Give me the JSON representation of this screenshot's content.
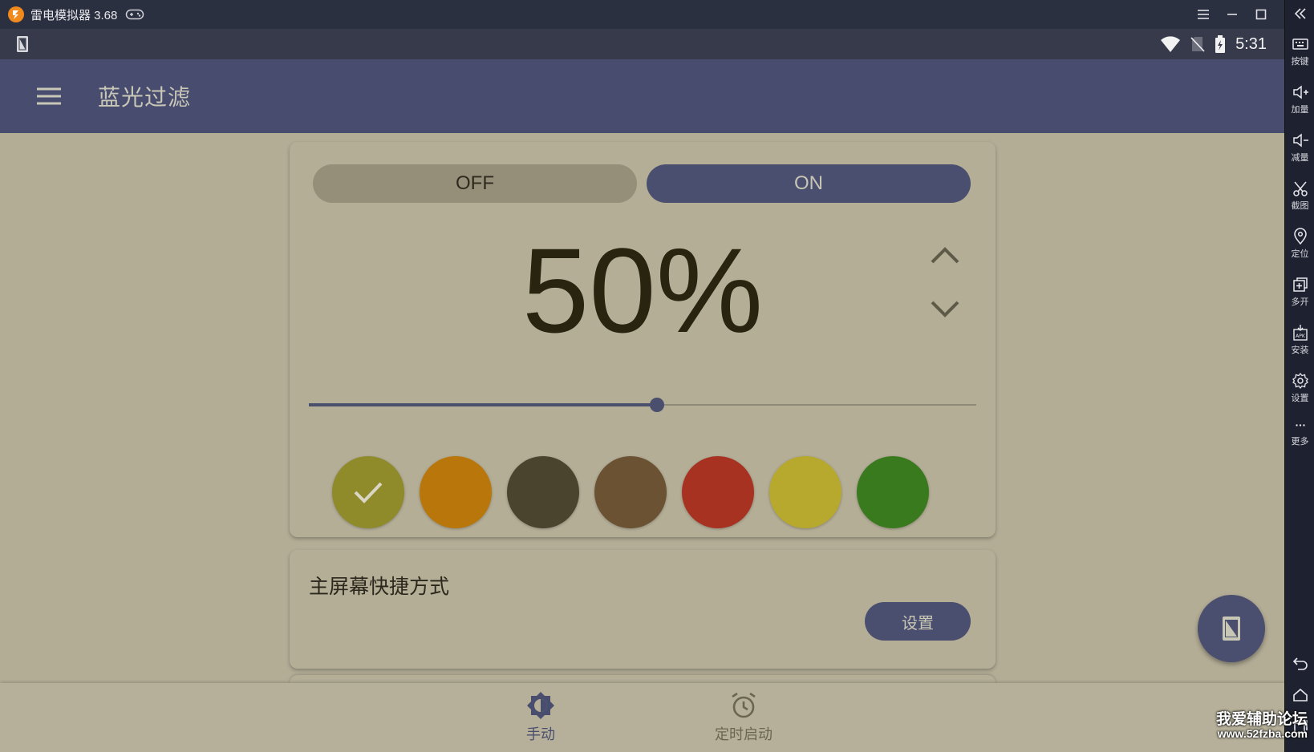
{
  "emulator": {
    "title": "雷电模拟器 3.68",
    "accent_color": "#f08a1c",
    "toolbar": [
      {
        "icon": "keyboard-icon",
        "label": "按键"
      },
      {
        "icon": "volume-up-icon",
        "label": "加量"
      },
      {
        "icon": "volume-down-icon",
        "label": "减量"
      },
      {
        "icon": "scissors-icon",
        "label": "截图"
      },
      {
        "icon": "location-pin-icon",
        "label": "定位"
      },
      {
        "icon": "multi-instance-icon",
        "label": "多开"
      },
      {
        "icon": "apk-install-icon",
        "label": "安装"
      },
      {
        "icon": "gear-icon",
        "label": "设置"
      },
      {
        "icon": "more-dots-icon",
        "label": "更多"
      }
    ]
  },
  "status_bar": {
    "time": "5:31"
  },
  "app_bar": {
    "title": "蓝光过滤"
  },
  "filter_card": {
    "toggle": {
      "off_label": "OFF",
      "on_label": "ON",
      "selected": "ON"
    },
    "intensity_label": "50%",
    "intensity_value": 50,
    "colors": [
      "#8f8a2a",
      "#b9760a",
      "#4a432e",
      "#6b5233",
      "#a83222",
      "#b7a82e",
      "#3a7a1e"
    ],
    "selected_color_index": 0
  },
  "shortcut_card": {
    "title": "主屏幕快捷方式",
    "button_label": "设置"
  },
  "bottom_nav": {
    "items": [
      {
        "label": "手动",
        "icon": "brightness-icon",
        "active": true
      },
      {
        "label": "定时启动",
        "icon": "alarm-clock-icon",
        "active": false
      }
    ]
  },
  "watermark": {
    "line1": "我爱辅助论坛",
    "line2": "www.52fzba.com"
  }
}
